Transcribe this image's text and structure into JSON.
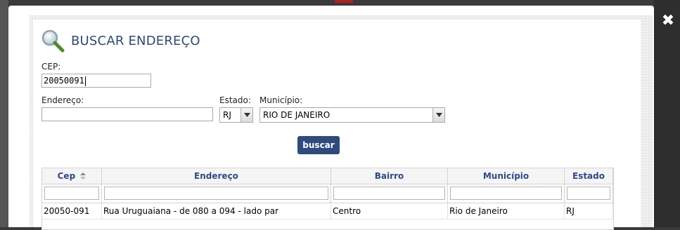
{
  "window": {
    "close_glyph": "✖"
  },
  "header": {
    "title": "BUSCAR ENDEREÇO",
    "icon": "search-icon"
  },
  "form": {
    "cep_label": "CEP:",
    "cep_value": "20050091",
    "endereco_label": "Endereço:",
    "endereco_value": "",
    "estado_label": "Estado:",
    "estado_value": "RJ",
    "municipio_label": "Município:",
    "municipio_value": "RIO DE JANEIRO",
    "buscar_label": "buscar"
  },
  "table": {
    "columns": [
      "Cep",
      "Endereço",
      "Bairro",
      "Município",
      "Estado"
    ],
    "rows": [
      [
        "20050-091",
        "Rua Uruguaiana - de 080 a 094 - lado par",
        "Centro",
        "Rio de Janeiro",
        "RJ"
      ]
    ]
  },
  "colors": {
    "accent": "#2f4b7d",
    "header_text": "#2d4a8a"
  }
}
